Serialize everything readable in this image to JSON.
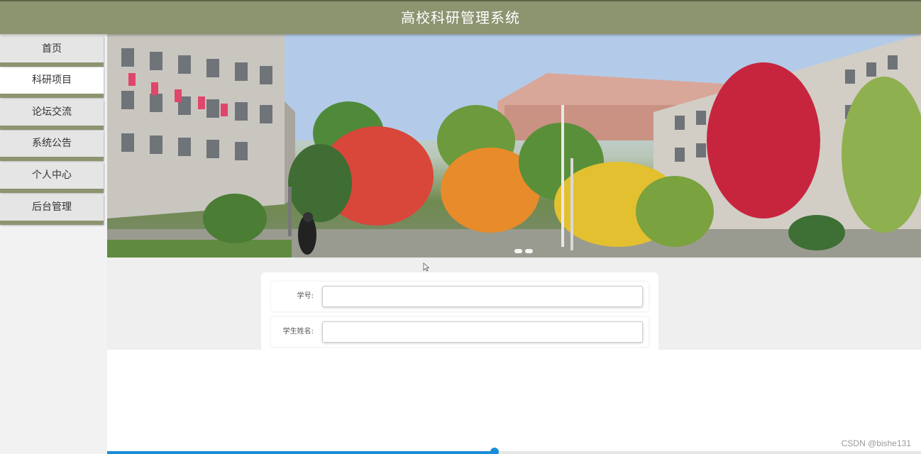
{
  "app": {
    "title": "高校科研管理系统"
  },
  "sidebar": {
    "items": [
      {
        "label": "首页",
        "active": false
      },
      {
        "label": "科研项目",
        "active": true
      },
      {
        "label": "论坛交流",
        "active": false
      },
      {
        "label": "系统公告",
        "active": false
      },
      {
        "label": "个人中心",
        "active": false
      },
      {
        "label": "后台管理",
        "active": false
      }
    ]
  },
  "banner": {
    "slide_indicators": 2
  },
  "form": {
    "fields": [
      {
        "label": "学号:",
        "value": "",
        "placeholder": ""
      },
      {
        "label": "学生姓名:",
        "value": "",
        "placeholder": ""
      }
    ]
  },
  "progress": {
    "fraction": 0.537
  },
  "watermark": {
    "text": "CSDN @bishe131"
  },
  "colors": {
    "header": "#8c9470",
    "accent": "#1a8cd8"
  }
}
